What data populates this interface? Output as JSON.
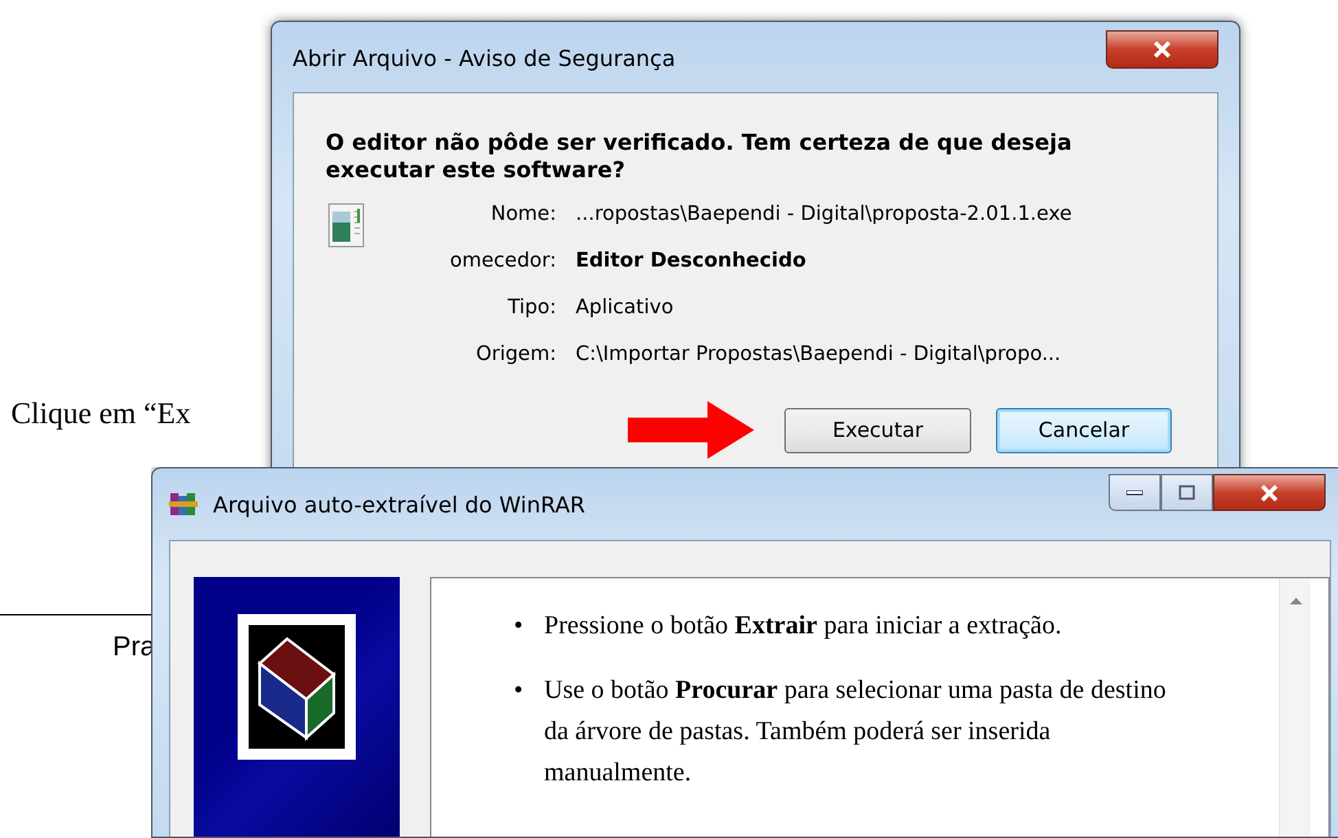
{
  "document": {
    "paragraph": "Clique em “Ex",
    "footer_text": "Pra"
  },
  "security_dialog": {
    "title": "Abrir Arquivo - Aviso de Segurança",
    "question": "O editor não pôde ser verificado. Tem certeza de que deseja executar este software?",
    "fields": [
      {
        "label": "Nome:",
        "value": "...ropostas\\Baependi - Digital\\proposta-2.01.1.exe",
        "bold": false
      },
      {
        "label": "omecedor:",
        "value": "Editor Desconhecido",
        "bold": true
      },
      {
        "label": "Tipo:",
        "value": "Aplicativo",
        "bold": false
      },
      {
        "label": "Origem:",
        "value": "C:\\Importar Propostas\\Baependi - Digital\\propo...",
        "bold": false
      }
    ],
    "buttons": [
      {
        "label": "Executar",
        "focused": false,
        "highlighted": true
      },
      {
        "label": "Cancelar",
        "focused": true,
        "highlighted": false
      }
    ]
  },
  "winrar_window": {
    "title": "Arquivo auto-extraível do WinRAR",
    "bullets": [
      {
        "marker": "•",
        "text": "Pressione o botão **Extrair** para iniciar a extração."
      },
      {
        "marker": "•",
        "text": "Use o botão **Procurar** para selecionar uma pasta de destino da árvore de pastas. Também poderá ser inserida manualmente."
      }
    ]
  }
}
